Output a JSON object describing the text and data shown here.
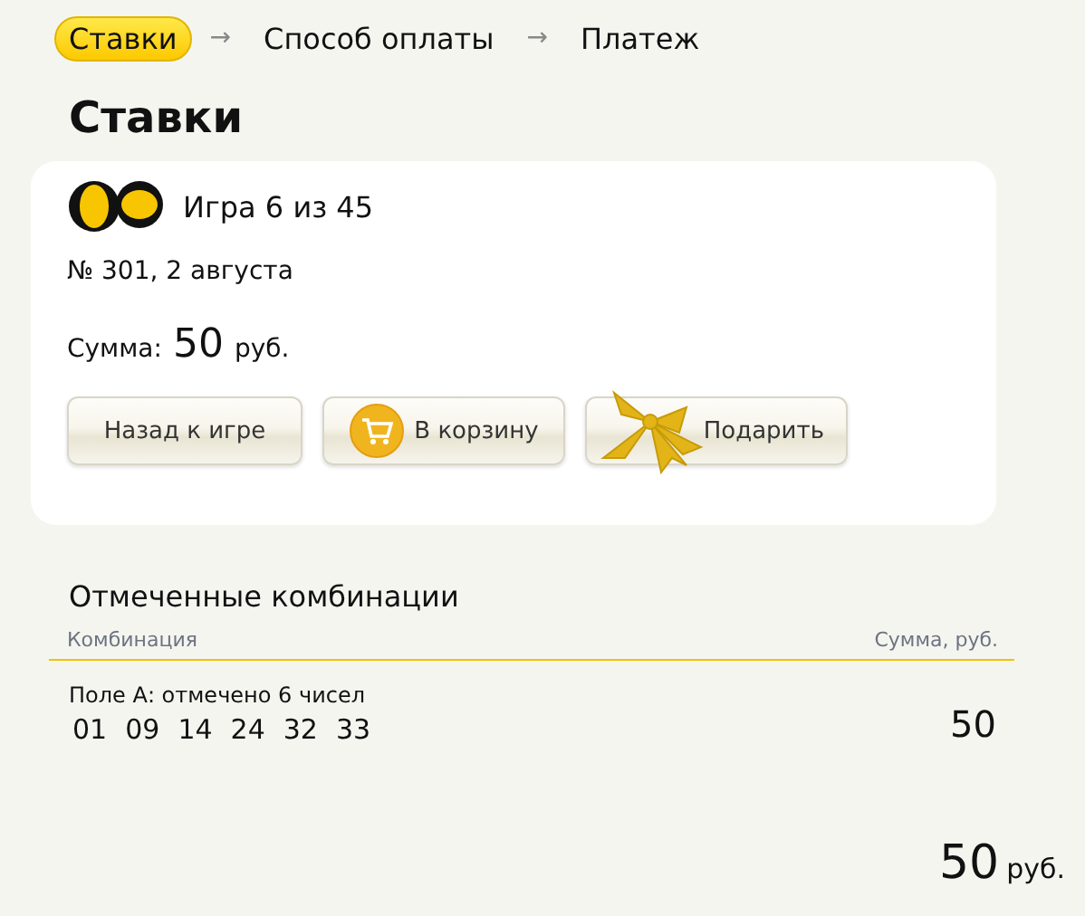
{
  "breadcrumb": [
    {
      "label": "Ставки",
      "selected": true
    },
    {
      "separator": "→"
    },
    {
      "label": "Способ оплаты",
      "selected": false
    },
    {
      "separator": "→"
    },
    {
      "label": "Платеж",
      "selected": false
    }
  ],
  "heading": "Ставки",
  "ticket": {
    "game": "Игра 6 из 45",
    "draw": "№ 301, 2 августа",
    "sum_label": "Сумма:",
    "sum_value": "50",
    "sum_currency": "руб.",
    "buttons": [
      {
        "kind": "plain",
        "label": "Назад к игре"
      },
      {
        "kind": "cart",
        "label": "В корзину"
      },
      {
        "kind": "gift",
        "label": "Подарить"
      }
    ]
  },
  "combinations": {
    "title": "Отмеченные комбинации",
    "columns": [
      "Комбинация",
      "Сумма, руб."
    ],
    "rows": [
      {
        "field": "Поле А: отмечено 6 чисел",
        "numbers": [
          "01",
          "09",
          "14",
          "24",
          "32",
          "33"
        ],
        "sum": "50"
      }
    ],
    "total_value": "50",
    "total_currency": "руб."
  }
}
